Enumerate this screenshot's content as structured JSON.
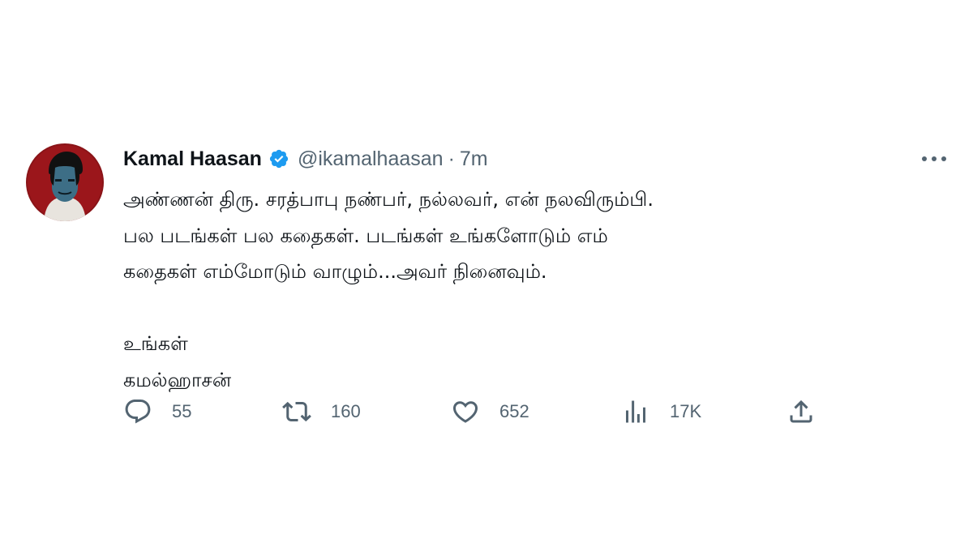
{
  "tweet": {
    "author": {
      "name": "Kamal Haasan",
      "handle": "@ikamalhaasan",
      "verified": true,
      "avatar_icon": "avatar-portrait-icon"
    },
    "separator": "·",
    "time": "7m",
    "more_icon": "more-horizontal-icon",
    "text_lines": [
      "அண்ணன் திரு. சரத்பாபு நண்பர், நல்லவர், என் நலவிரும்பி.",
      "பல படங்கள் பல கதைகள். படங்கள் உங்களோடும் எம்",
      "கதைகள் எம்மோடும் வாழும்...அவர் நினைவும்.",
      "உங்கள்",
      "கமல்ஹாசன்"
    ],
    "actions": {
      "reply": {
        "icon": "reply-icon",
        "count": "55"
      },
      "retweet": {
        "icon": "retweet-icon",
        "count": "160"
      },
      "like": {
        "icon": "heart-icon",
        "count": "652"
      },
      "views": {
        "icon": "views-chart-icon",
        "count": "17K"
      },
      "share": {
        "icon": "share-icon"
      }
    },
    "colors": {
      "text": "#0f1419",
      "secondary": "#536471",
      "verified": "#1d9bf0"
    }
  }
}
